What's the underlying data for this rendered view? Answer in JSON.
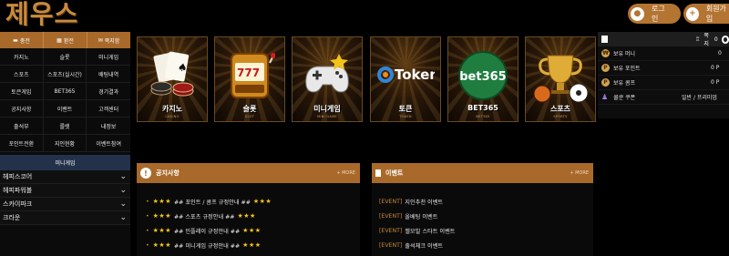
{
  "brand": {
    "logo_text": "제우스"
  },
  "header": {
    "login_label": "로그인",
    "signup_label": "회원가입"
  },
  "sidebar": {
    "tabs": [
      {
        "label": "충전",
        "icon": "card-icon"
      },
      {
        "label": "환전",
        "icon": "bank-icon"
      },
      {
        "label": "쪽지함",
        "icon": "message-icon"
      }
    ],
    "grid": [
      "카지노",
      "슬롯",
      "미니게임",
      "스포츠",
      "스포츠(실시간)",
      "배팅내역",
      "토큰게임",
      "BET365",
      "경기결과",
      "공지사항",
      "이벤트",
      "고객센터",
      "출석부",
      "룰렛",
      "내정보",
      "포인트전환",
      "지인현황",
      "이벤트참여"
    ],
    "mini_game_label": "미니게임",
    "accordion": [
      "헤피스코어",
      "헤피파워볼",
      "스카이파크",
      "크라운"
    ]
  },
  "games": [
    {
      "name": "카지노",
      "sub": "CASINO"
    },
    {
      "name": "슬롯",
      "sub": "SLOT"
    },
    {
      "name": "미니게임",
      "sub": "MINI GAME"
    },
    {
      "name": "토큰",
      "sub": "TOKEN"
    },
    {
      "name": "BET365",
      "sub": "BET365"
    },
    {
      "name": "스포츠",
      "sub": "SPORTS"
    }
  ],
  "game_art": {
    "token_text": "Token",
    "bet365_text": "bet365"
  },
  "user_panel": {
    "messages_label": "쪽지",
    "messages_count": "0",
    "rows": [
      {
        "label": "보유 머니",
        "value": "0"
      },
      {
        "label": "보유 포인트",
        "value": "0 P"
      },
      {
        "label": "보유 콤프",
        "value": "0 P"
      },
      {
        "label": "쿨쿤 쿠폰",
        "value": "일반 / 프리미엄"
      }
    ]
  },
  "notice": {
    "title": "공지사항",
    "more": "+ MORE",
    "items": [
      "## 포인트 / 콤프 규정안내 ##",
      "## 스포츠 규정안내 ##",
      "## 인플레이 규정안내 ##",
      "## 미니게임 규정안내 ##"
    ]
  },
  "event": {
    "title": "이벤트",
    "more": "+ MORE",
    "tag": "[EVENT]",
    "items": [
      "지인추천 이벤트",
      "올베팅 이벤트",
      "첼모빌 스타트 이벤트",
      "출석체크 이벤트"
    ]
  },
  "colors": {
    "accent": "#a8692a",
    "gold": "#c98a3e",
    "star": "#f2c31a",
    "mini_bar": "#23324a"
  }
}
